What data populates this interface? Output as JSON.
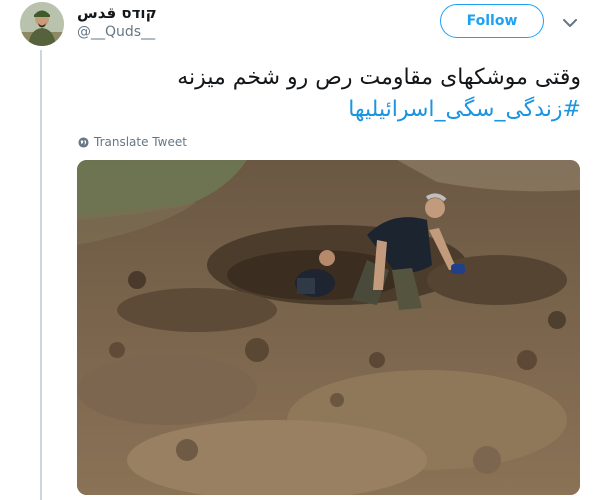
{
  "user": {
    "display_name": "קודס قدس",
    "handle": "@__Quds__"
  },
  "follow_button": {
    "label": "Follow"
  },
  "tweet": {
    "text_line1": "وقتی موشکهای مقاومت رص رو شخم میزنه",
    "hashtag": "#زندگی_سگی_اسرائیلیها"
  },
  "translate": {
    "label": "Translate Tweet"
  },
  "icons": {
    "menu": "chevron-down-icon",
    "translate": "globe-icon"
  },
  "colors": {
    "accent": "#1da1f2",
    "hashtag": "#1b95e0",
    "muted": "#657786",
    "thread_line": "#ccd6dd"
  }
}
